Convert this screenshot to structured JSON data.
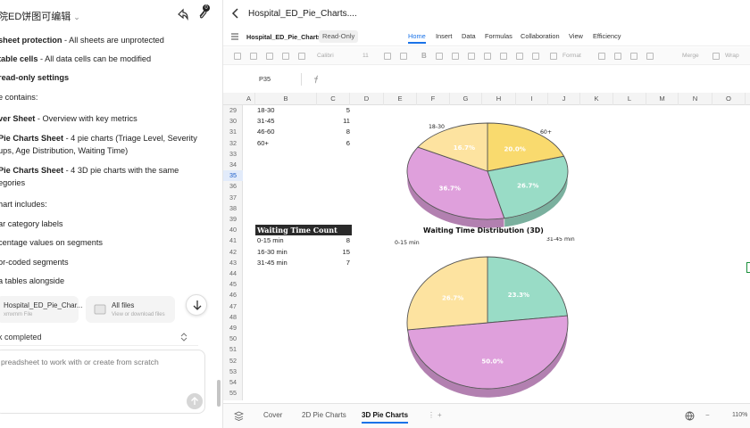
{
  "left": {
    "title": "院ED饼图可编辑",
    "badge": "0",
    "lines": [
      {
        "bold": "sheet protection",
        "rest": " - All sheets are unprotected"
      },
      {
        "bold": "table cells",
        "rest": " - All data cells can be modified"
      },
      {
        "bold": "read-only settings",
        "rest": ""
      },
      {
        "bold": "",
        "rest": "e contains:"
      },
      {
        "bold": "ver Sheet",
        "rest": " - Overview with key metrics"
      },
      {
        "bold": "Pie Charts Sheet",
        "rest": " - 4 pie charts (Triage Level, Severity"
      },
      {
        "bold": "",
        "rest": "ups, Age Distribution, Waiting Time)"
      },
      {
        "bold": "Pie Charts Sheet",
        "rest": " - 4 3D pie charts with the same"
      },
      {
        "bold": "",
        "rest": "egories"
      },
      {
        "bold": "",
        "rest": "hart includes:"
      },
      {
        "bold": "",
        "rest": "ar category labels"
      },
      {
        "bold": "",
        "rest": "centage values on segments"
      },
      {
        "bold": "",
        "rest": "or-coded segments"
      },
      {
        "bold": "",
        "rest": "a tables alongside"
      }
    ],
    "file_card_1": {
      "name": "Hospital_ED_Pie_Char...",
      "sub": "xmxmm File"
    },
    "file_card_2": {
      "name": "All files",
      "sub": "View or download files"
    },
    "task_status": "k completed",
    "input_placeholder": "preadsheet to work with or create from scratch"
  },
  "doc": {
    "title": "Hospital_ED_Pie_Charts....",
    "file_name": "Hospital_ED_Pie_Charts",
    "read_only": "Read-Only",
    "menu": [
      "Home",
      "Insert",
      "Data",
      "Formulas",
      "Collaboration",
      "View",
      "Efficiency"
    ],
    "toolbar": {
      "font": "Calibri",
      "size": "11",
      "format": "Format",
      "merge": "Merge",
      "wrap": "Wrap"
    },
    "name_box": "P35",
    "columns": [
      "A",
      "B",
      "C",
      "D",
      "E",
      "F",
      "G",
      "H",
      "I",
      "J",
      "K",
      "L",
      "M",
      "N",
      "O"
    ],
    "rows": [
      "29",
      "30",
      "31",
      "32",
      "33",
      "34",
      "35",
      "36",
      "37",
      "38",
      "39",
      "40",
      "41",
      "42",
      "43",
      "44",
      "45",
      "46",
      "47",
      "48",
      "49",
      "50",
      "51",
      "52",
      "53",
      "54",
      "55",
      "56"
    ],
    "age_rows": [
      {
        "label": "18-30",
        "value": "5"
      },
      {
        "label": "31-45",
        "value": "11"
      },
      {
        "label": "46-60",
        "value": "8"
      },
      {
        "label": "60+",
        "value": "6"
      }
    ],
    "wait_header": "Waiting Time Count",
    "wait_rows": [
      {
        "label": "0-15 min",
        "value": "8"
      },
      {
        "label": "16-30 min",
        "value": "15"
      },
      {
        "label": "31-45 min",
        "value": "7"
      }
    ],
    "sheet_tabs": [
      "Cover",
      "2D Pie Charts",
      "3D Pie Charts"
    ],
    "zoom": "110%"
  },
  "chart_data": [
    {
      "type": "pie",
      "title": "",
      "categories": [
        "18-30",
        "31-45",
        "46-60",
        "60+"
      ],
      "values": [
        16.7,
        36.7,
        26.7,
        20.0
      ],
      "value_labels": [
        "16.7%",
        "36.7%",
        "26.7%",
        "20.0%"
      ],
      "colors": [
        "#fde3a0",
        "#dfa0dc",
        "#99dcc6",
        "#f9da6e"
      ],
      "visible_outer_labels": [
        "18-30",
        "60+"
      ]
    },
    {
      "type": "pie",
      "title": "Waiting Time Distribution (3D)",
      "categories": [
        "0-15 min",
        "16-30 min",
        "31-45 min"
      ],
      "values": [
        26.7,
        50.0,
        23.3
      ],
      "value_labels": [
        "26.7%",
        "50.0%",
        "23.3%"
      ],
      "colors": [
        "#fde3a0",
        "#dfa0dc",
        "#99dcc6"
      ],
      "visible_outer_labels": [
        "0-15 min",
        "31-45 min"
      ]
    }
  ]
}
